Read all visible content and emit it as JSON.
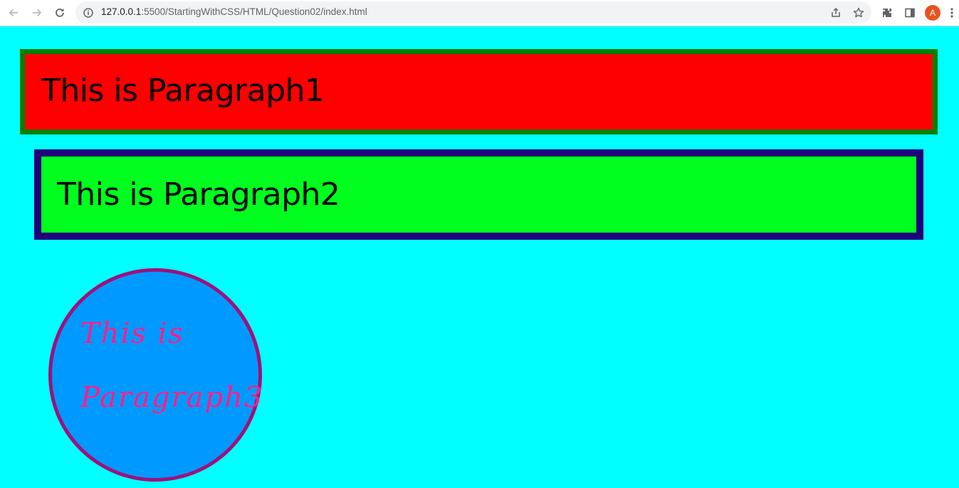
{
  "browser": {
    "url_host": "127.0.0.1",
    "url_path": ":5500/StartingWithCSS/HTML/Question02/index.html",
    "profile_initial": "A"
  },
  "page": {
    "background": "#00ffff",
    "paragraph1": {
      "text": "This is Paragraph1",
      "background": "#ff0000",
      "border_color": "#008000"
    },
    "paragraph2": {
      "text": "This is Paragraph2",
      "background": "#00ff1e",
      "border_color": "#22007a"
    },
    "paragraph3": {
      "line1": "This is",
      "line2": "Paragraph3",
      "background": "#0099ff",
      "border_color": "#a0107c",
      "text_color": "#ff1f8c"
    }
  }
}
